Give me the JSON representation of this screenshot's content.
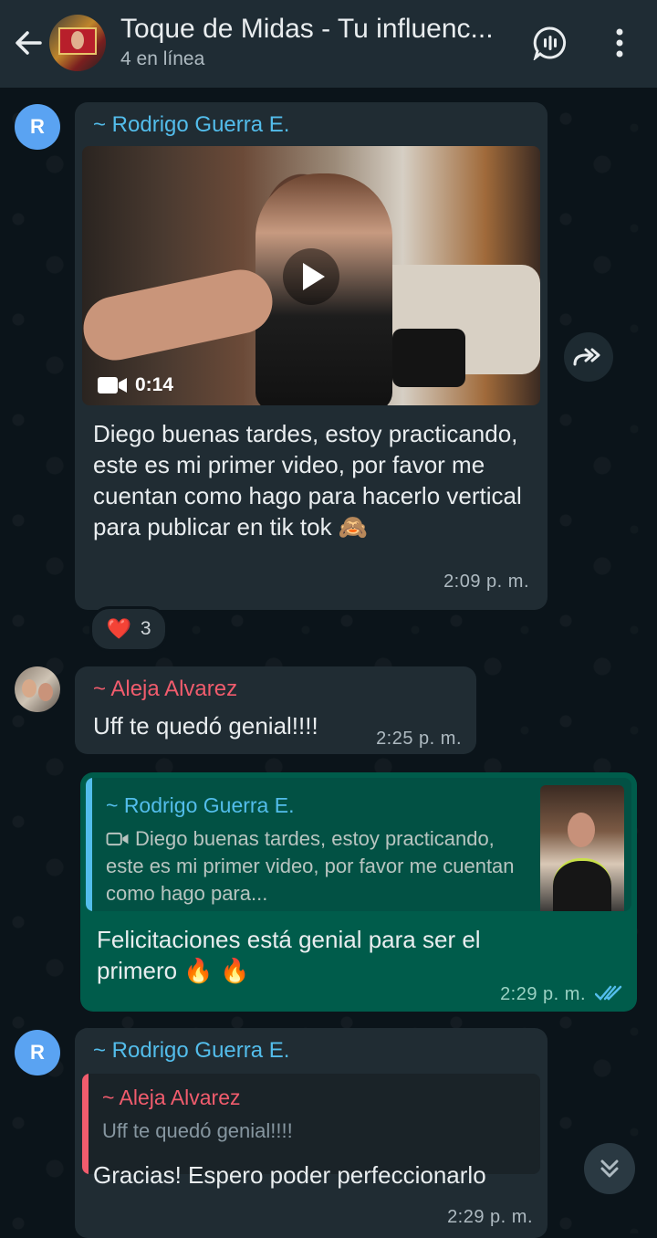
{
  "header": {
    "title": "Toque de Midas - Tu influenc...",
    "subtitle": "4 en línea",
    "back_icon": "arrow-left-icon",
    "call_icon": "voice-chat-icon",
    "menu_icon": "more-vertical-icon"
  },
  "messages": [
    {
      "avatar_initial": "R",
      "sender": "~ Rodrigo Guerra E.",
      "video_duration": "0:14",
      "text": "Diego buenas tardes, estoy practicando, este es mi primer video, por favor me cuentan como hago para hacerlo vertical para publicar en tik tok 🙈",
      "time": "2:09 p. m.",
      "reaction": {
        "emoji": "❤️",
        "count": "3"
      }
    },
    {
      "sender": "~ Aleja Alvarez",
      "text": "Uff te quedó genial!!!!",
      "time": "2:25 p. m."
    },
    {
      "quoted_sender": "~ Rodrigo Guerra E.",
      "quoted_text": "Diego buenas tardes, estoy practicando, este es mi primer video, por favor me cuentan como hago para...",
      "text": "Felicitaciones está genial para ser el primero 🔥 🔥",
      "time": "2:29 p. m.",
      "status": "read"
    },
    {
      "avatar_initial": "R",
      "sender": "~ Rodrigo Guerra E.",
      "quoted_sender": "~ Aleja Alvarez",
      "quoted_text": "Uff te quedó genial!!!!",
      "text": "Gracias! Espero poder perfeccionarlo",
      "time": "2:29 p. m."
    }
  ],
  "colors": {
    "header_bg": "#1f2c34",
    "incoming_bubble": "#202c33",
    "outgoing_bubble": "#005c4b",
    "sender_blue": "#53bdeb",
    "sender_red": "#f15c6d",
    "read_ticks": "#53bdeb"
  }
}
